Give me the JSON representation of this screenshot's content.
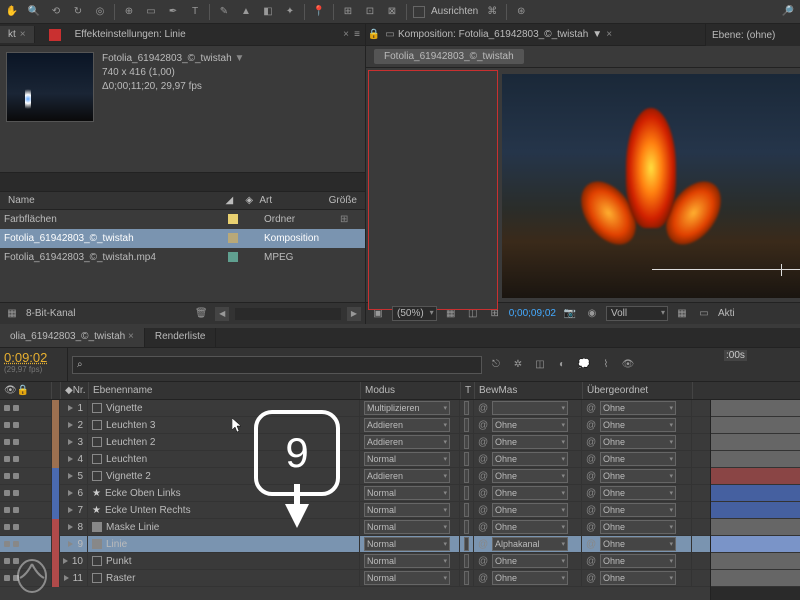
{
  "toolbar": {
    "align_label": "Ausrichten"
  },
  "effect_panel": {
    "tab_short": "kt",
    "title_prefix": "Effekteinstellungen:",
    "title_item": "Linie"
  },
  "project": {
    "name": "Fotolia_61942803_©_twistah",
    "dims": "740 x 416 (1,00)",
    "duration": "Δ0;00;11;20, 29,97 fps",
    "col_name": "Name",
    "col_type": "Art",
    "col_size": "Größe",
    "rows": [
      {
        "name": "Farbflächen",
        "type": "Ordner",
        "swatch": "sw-yellow"
      },
      {
        "name": "Fotolia_61942803_©_twistah",
        "type": "Komposition",
        "swatch": "sw-tan"
      },
      {
        "name": "Fotolia_61942803_©_twistah.mp4",
        "type": "MPEG",
        "swatch": "sw-teal"
      }
    ],
    "bit_depth": "8-Bit-Kanal"
  },
  "composition": {
    "tab_prefix": "Komposition:",
    "tab_name": "Fotolia_61942803_©_twistah",
    "subtab": "Fotolia_61942803_©_twistah",
    "zoom": "(50%)",
    "timecode": "0;00;09;02",
    "res": "Voll",
    "active": "Akti"
  },
  "layer_panel": {
    "label": "Ebene: (ohne)"
  },
  "timeline": {
    "tab_name": "olia_61942803_©_twistah",
    "render_tab": "Renderliste",
    "time_main": "0:09:02",
    "time_sub": "(29,97 fps)",
    "ruler_time": ":00s",
    "col_nr": "Nr.",
    "col_name": "Ebenenname",
    "col_mode": "Modus",
    "col_t": "T",
    "col_bewmas": "BewMas",
    "col_parent": "Übergeordnet",
    "layers": [
      {
        "nr": "1",
        "name": "Vignette",
        "mode": "Multiplizieren",
        "bm": "",
        "parent": "Ohne",
        "color": "#9c7050",
        "icon": "sq",
        "track": "tr-gray"
      },
      {
        "nr": "2",
        "name": "Leuchten 3",
        "mode": "Addieren",
        "bm": "Ohne",
        "parent": "Ohne",
        "color": "#9c7050",
        "icon": "sq",
        "track": "tr-gray"
      },
      {
        "nr": "3",
        "name": "Leuchten 2",
        "mode": "Addieren",
        "bm": "Ohne",
        "parent": "Ohne",
        "color": "#9c7050",
        "icon": "sq",
        "track": "tr-gray"
      },
      {
        "nr": "4",
        "name": "Leuchten",
        "mode": "Normal",
        "bm": "Ohne",
        "parent": "Ohne",
        "color": "#9c7050",
        "icon": "sq",
        "track": "tr-gray"
      },
      {
        "nr": "5",
        "name": "Vignette 2",
        "mode": "Addieren",
        "bm": "Ohne",
        "parent": "Ohne",
        "color": "#4a6ab0",
        "icon": "sq",
        "track": "tr-red"
      },
      {
        "nr": "6",
        "name": "Ecke Oben Links",
        "mode": "Normal",
        "bm": "Ohne",
        "parent": "Ohne",
        "color": "#4a6ab0",
        "icon": "star",
        "track": "tr-blue"
      },
      {
        "nr": "7",
        "name": "Ecke Unten Rechts",
        "mode": "Normal",
        "bm": "Ohne",
        "parent": "Ohne",
        "color": "#4a6ab0",
        "icon": "star",
        "track": "tr-blue"
      },
      {
        "nr": "8",
        "name": "Maske Linie",
        "mode": "Normal",
        "bm": "Ohne",
        "parent": "Ohne",
        "color": "#b04a4a",
        "icon": "fill",
        "track": "tr-gray"
      },
      {
        "nr": "9",
        "name": "Linie",
        "mode": "Normal",
        "bm": "Alphakanal",
        "parent": "Ohne",
        "color": "#b04a4a",
        "icon": "fill",
        "track": "tr-ltblue",
        "sel": true
      },
      {
        "nr": "10",
        "name": "Punkt",
        "mode": "Normal",
        "bm": "Ohne",
        "parent": "Ohne",
        "color": "#b04a4a",
        "icon": "sq",
        "track": "tr-gray"
      },
      {
        "nr": "11",
        "name": "Raster",
        "mode": "Normal",
        "bm": "Ohne",
        "parent": "Ohne",
        "color": "#b04a4a",
        "icon": "sq",
        "track": "tr-gray"
      }
    ]
  },
  "callout": {
    "number": "9"
  }
}
